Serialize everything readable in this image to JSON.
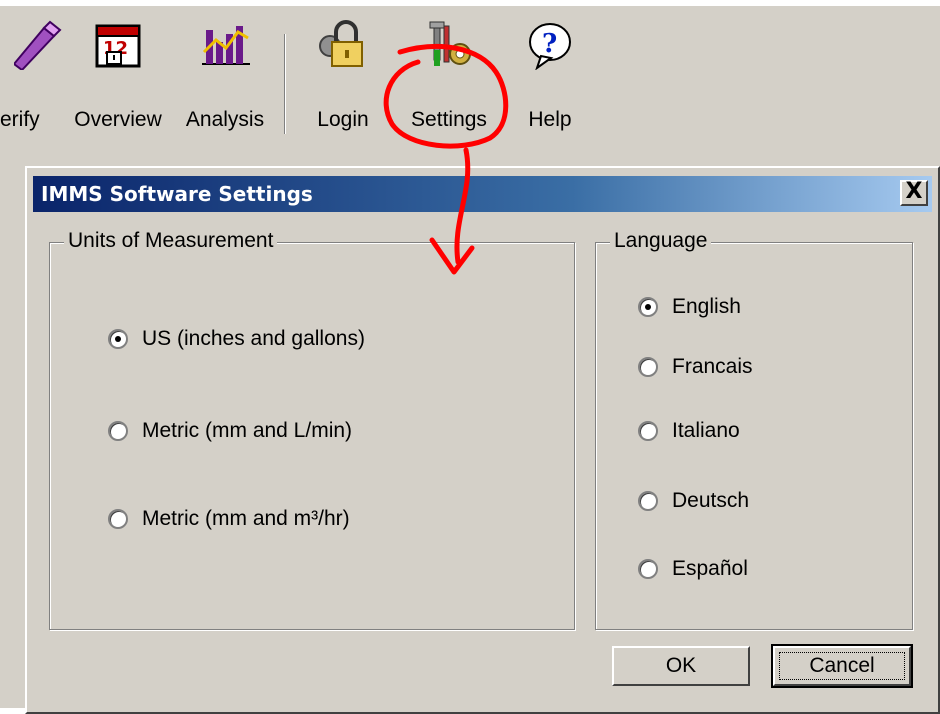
{
  "toolbar": {
    "buttons": [
      {
        "label": "erify",
        "icon": "pencil-icon"
      },
      {
        "label": "Overview",
        "icon": "calendar-icon"
      },
      {
        "label": "Analysis",
        "icon": "bar-chart-icon"
      },
      {
        "label": "Login",
        "icon": "padlock-icon"
      },
      {
        "label": "Settings",
        "icon": "tools-gear-icon"
      },
      {
        "label": "Help",
        "icon": "question-bubble-icon"
      }
    ]
  },
  "dialog": {
    "title": "IMMS Software Settings",
    "close_label": "X",
    "units": {
      "legend": "Units of Measurement",
      "options": [
        {
          "label": "US (inches and gallons)",
          "checked": true
        },
        {
          "label": "Metric (mm and L/min)",
          "checked": false
        },
        {
          "label": "Metric (mm and m³/hr)",
          "checked": false
        }
      ]
    },
    "language": {
      "legend": "Language",
      "options": [
        {
          "label": "English",
          "checked": true
        },
        {
          "label": "Francais",
          "checked": false
        },
        {
          "label": "Italiano",
          "checked": false
        },
        {
          "label": "Deutsch",
          "checked": false
        },
        {
          "label": "Español",
          "checked": false
        }
      ]
    },
    "ok_label": "OK",
    "cancel_label": "Cancel"
  },
  "annotation": {
    "color": "#ff0000"
  }
}
